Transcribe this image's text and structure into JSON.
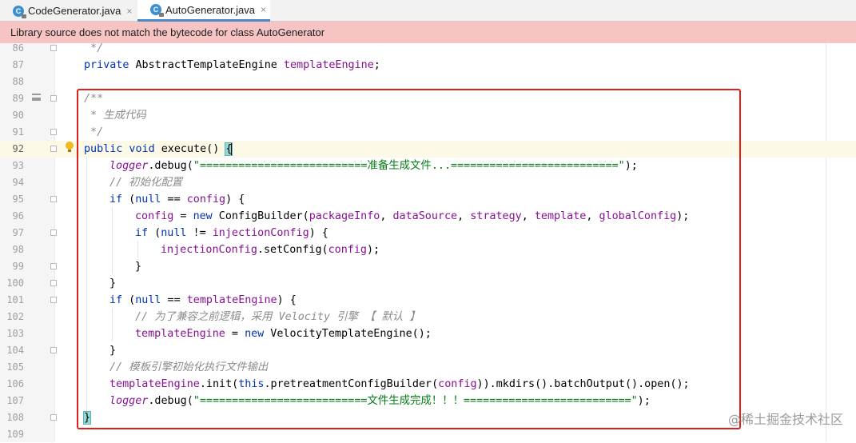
{
  "tabs": [
    {
      "label": "CodeGenerator.java",
      "icon": "java-class-icon",
      "active": false
    },
    {
      "label": "AutoGenerator.java",
      "icon": "java-class-icon",
      "active": true
    }
  ],
  "tab_close_glyph": "×",
  "banner": {
    "text": "Library source does not match the bytecode for class AutoGenerator"
  },
  "editor": {
    "line_numbers": [
      "86",
      "87",
      "88",
      "89",
      "90",
      "91",
      "92",
      "93",
      "94",
      "95",
      "96",
      "97",
      "98",
      "99",
      "100",
      "101",
      "102",
      "103",
      "104",
      "105",
      "106",
      "107",
      "108",
      "109"
    ],
    "current_line": "92"
  },
  "code": {
    "l86": " */",
    "l87_kw": "private",
    "l87_type": " AbstractTemplateEngine ",
    "l87_field": "templateEngine",
    "l87_end": ";",
    "l89": "/**",
    "l90": " * 生成代码",
    "l91": " */",
    "l92_kw1": "public",
    "l92_kw2": " void",
    "l92_name": " execute() ",
    "l92_brace": "{",
    "l93_field": "logger",
    "l93_call": ".debug(",
    "l93_str": "\"==========================准备生成文件...==========================\"",
    "l93_end": ");",
    "l94": "// 初始化配置",
    "l95_kw": "if",
    "l95_a": " (",
    "l95_null": "null",
    "l95_b": " == ",
    "l95_field": "config",
    "l95_c": ") {",
    "l96_field": "config",
    "l96_a": " = ",
    "l96_new": "new",
    "l96_b": " ConfigBuilder(",
    "l96_f1": "packageInfo",
    "l96_c1": ", ",
    "l96_f2": "dataSource",
    "l96_c2": ", ",
    "l96_f3": "strategy",
    "l96_c3": ", ",
    "l96_f4": "template",
    "l96_c4": ", ",
    "l96_f5": "globalConfig",
    "l96_end": ");",
    "l97_kw": "if",
    "l97_a": " (",
    "l97_null": "null",
    "l97_b": " != ",
    "l97_field": "injectionConfig",
    "l97_c": ") {",
    "l98_field": "injectionConfig",
    "l98_a": ".setConfig(",
    "l98_arg": "config",
    "l98_end": ");",
    "l99": "}",
    "l100": "}",
    "l101_kw": "if",
    "l101_a": " (",
    "l101_null": "null",
    "l101_b": " == ",
    "l101_field": "templateEngine",
    "l101_c": ") {",
    "l102": "// 为了兼容之前逻辑，采用 Velocity 引擎 【 默认 】",
    "l103_field": "templateEngine",
    "l103_a": " = ",
    "l103_new": "new",
    "l103_b": " VelocityTemplateEngine();",
    "l104": "}",
    "l105": "// 模板引擎初始化执行文件输出",
    "l106_field": "templateEngine",
    "l106_a": ".init(",
    "l106_this": "this",
    "l106_b": ".pretreatmentConfigBuilder(",
    "l106_arg": "config",
    "l106_c": ")).mkdirs().batchOutput().open();",
    "l107_field": "logger",
    "l107_call": ".debug(",
    "l107_str": "\"==========================文件生成完成！！！==========================\"",
    "l107_end": ");",
    "l108": "}"
  },
  "watermark": "@稀土掘金技术社区",
  "colors": {
    "keyword": "#0033b3",
    "field": "#871094",
    "string": "#067d17",
    "comment": "#8c8c8c",
    "banner_bg": "#f6c4c3",
    "highlight_box": "#e0201b"
  }
}
